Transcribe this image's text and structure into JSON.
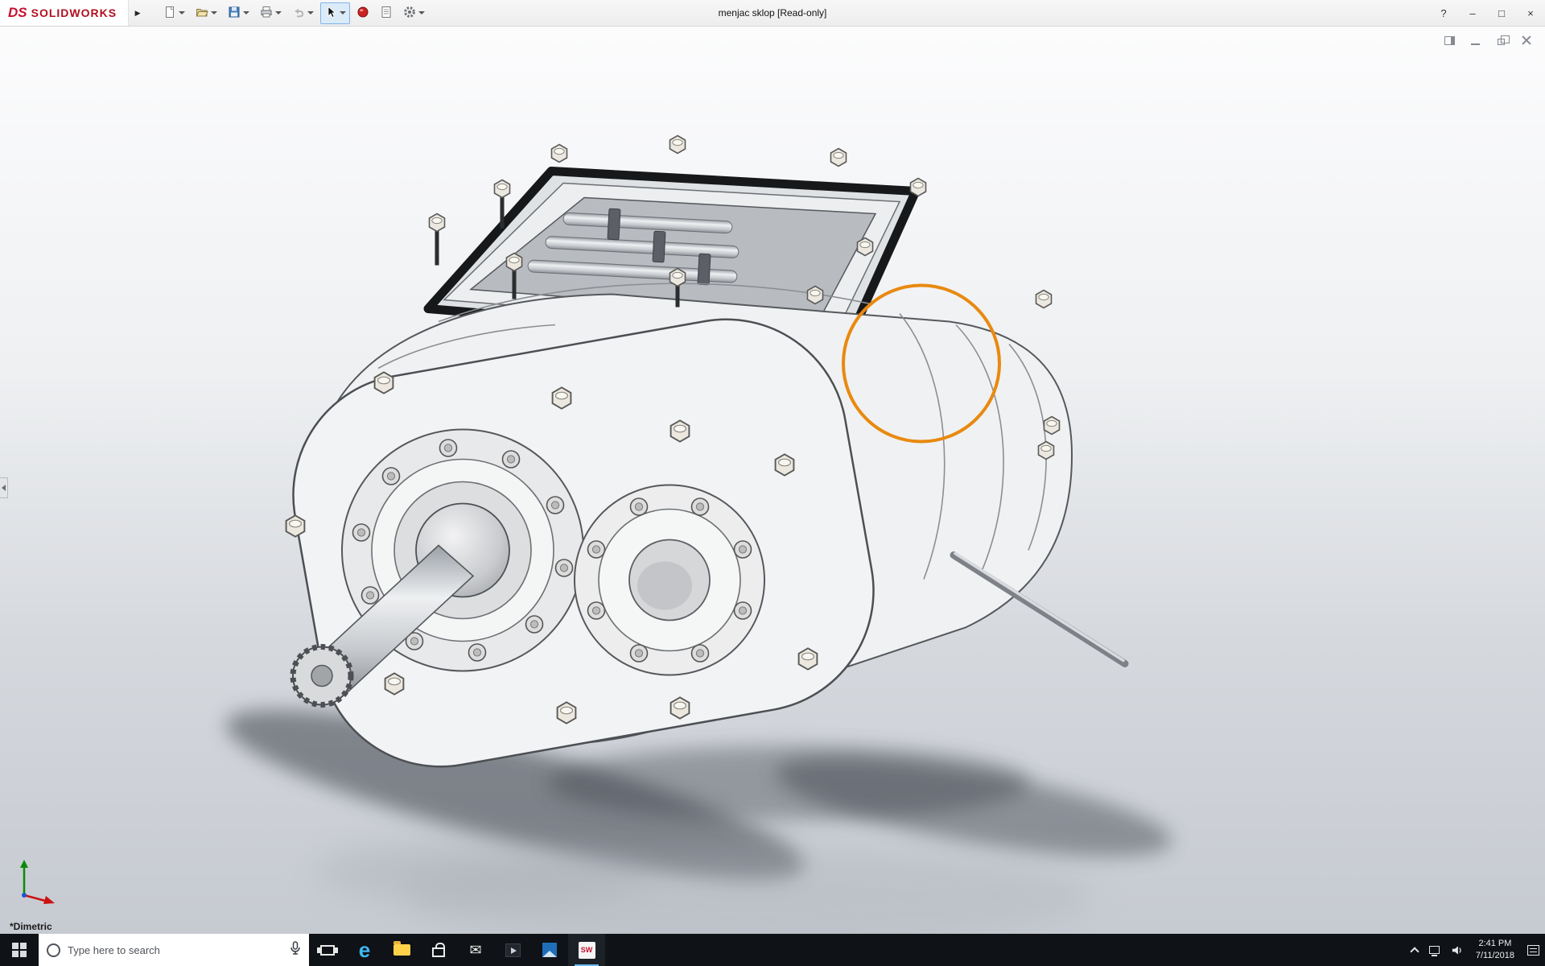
{
  "titlebar": {
    "logo_ds": "DS",
    "logo_text": "SOLIDWORKS",
    "expand_arrow": "▶",
    "document_title": "menjac sklop [Read-only]",
    "controls": {
      "help": "?",
      "minimize": "–",
      "maximize": "□",
      "close": "×"
    }
  },
  "toolbar": {
    "buttons": [
      {
        "name": "new-document",
        "dropdown": true
      },
      {
        "name": "open",
        "dropdown": true
      },
      {
        "name": "save",
        "dropdown": true
      },
      {
        "name": "print",
        "dropdown": true
      },
      {
        "name": "undo",
        "dropdown": true,
        "disabled": true
      },
      {
        "name": "select",
        "dropdown": true,
        "active": true
      },
      {
        "name": "rebuild",
        "dropdown": false
      },
      {
        "name": "file-properties",
        "dropdown": false
      },
      {
        "name": "options",
        "dropdown": true
      }
    ]
  },
  "document_window_controls": [
    "dock-pane",
    "minimize",
    "restore",
    "close"
  ],
  "viewport": {
    "view_orientation_label": "*Dimetric",
    "annotation_circle_color": "#E8890F"
  },
  "taskbar": {
    "search_placeholder": "Type here to search",
    "edge_glyph": "e",
    "mail_glyph": "✉",
    "solidworks_glyph": "SW",
    "apps": [
      "task-view",
      "edge",
      "file-explorer",
      "store",
      "mail",
      "film-tv",
      "photos",
      "solidworks-2017"
    ],
    "tray_icons": [
      "hidden-icons",
      "network",
      "volume",
      "clock",
      "action-center"
    ],
    "time": "2:41 PM",
    "date": "7/11/2018"
  }
}
